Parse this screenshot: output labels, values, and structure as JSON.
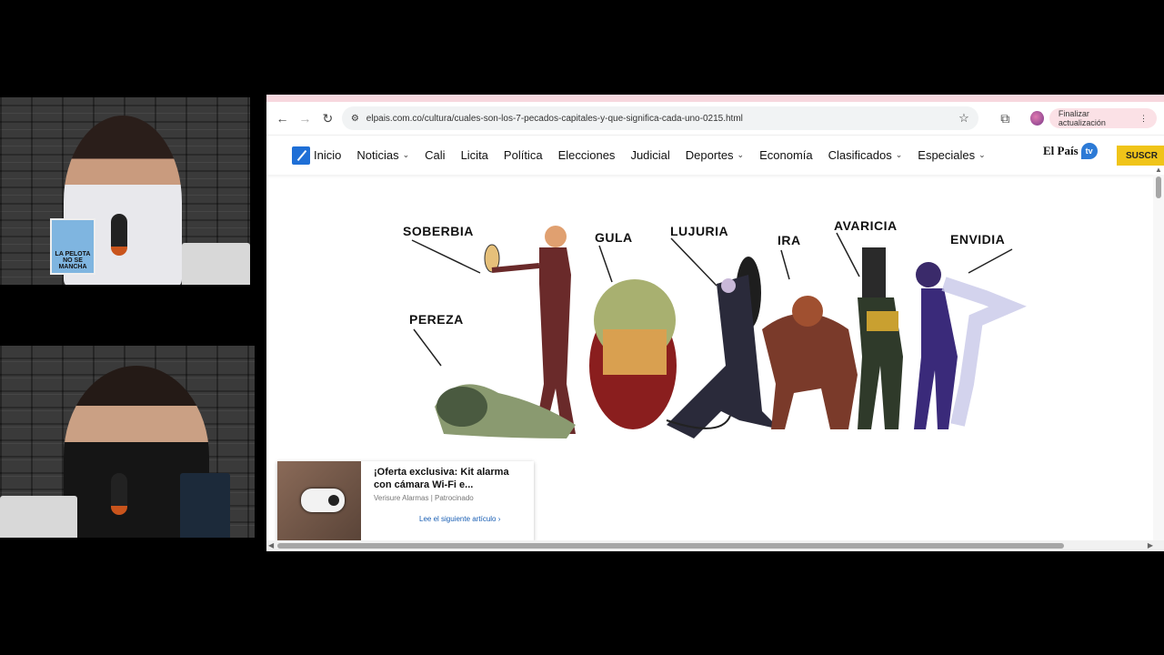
{
  "cams": {
    "top_poster": "LA PELOTA NO SE MANCHA"
  },
  "browser": {
    "url": "elpais.com.co/cultura/cuales-son-los-7-pecados-capitales-y-que-significa-cada-uno-0215.html",
    "update_label": "Finalizar actualización",
    "nav": {
      "items": [
        {
          "label": "Inicio",
          "dropdown": false
        },
        {
          "label": "Noticias",
          "dropdown": true
        },
        {
          "label": "Cali",
          "dropdown": false
        },
        {
          "label": "Licita",
          "dropdown": false
        },
        {
          "label": "Política",
          "dropdown": false
        },
        {
          "label": "Elecciones",
          "dropdown": false
        },
        {
          "label": "Judicial",
          "dropdown": false
        },
        {
          "label": "Deportes",
          "dropdown": true
        },
        {
          "label": "Economía",
          "dropdown": false
        },
        {
          "label": "Clasificados",
          "dropdown": true
        },
        {
          "label": "Especiales",
          "dropdown": true
        }
      ],
      "brand": "El País",
      "brand_tv": "tv",
      "subscribe": "SUSCR"
    },
    "illustration": {
      "labels": [
        "SOBERBIA",
        "GULA",
        "LUJURIA",
        "IRA",
        "AVARICIA",
        "ENVIDIA",
        "PEREZA"
      ]
    },
    "ad": {
      "title": "¡Oferta exclusiva: Kit alarma con cámara Wi-Fi e...",
      "advertiser": "Verisure Alarmas",
      "sponsored": "Patrocinado",
      "next_label": "Lee el siguiente artículo",
      "separator": "|"
    }
  },
  "icons": {
    "back": "←",
    "forward": "→",
    "reload": "↻",
    "site_info": "⚙",
    "star": "☆",
    "extensions": "⧉",
    "menu": "⋮",
    "chevron": "⌄",
    "next_arrow": "›",
    "scroll_up": "▲",
    "scroll_down": "▼",
    "scroll_left": "◀",
    "scroll_right": "▶"
  }
}
